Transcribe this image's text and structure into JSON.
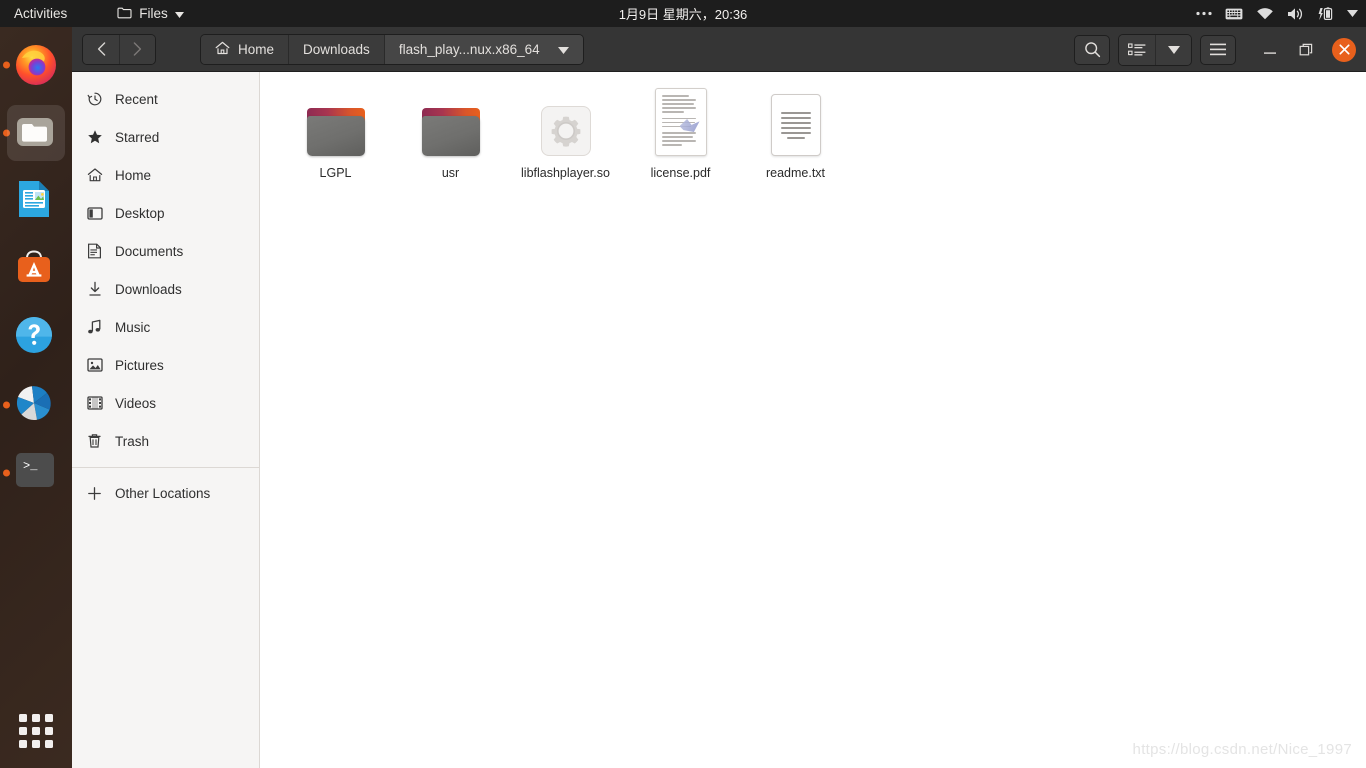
{
  "topbar": {
    "activities": "Activities",
    "app_name": "Files",
    "clock": "1月9日 星期六，20:36",
    "tray": [
      {
        "name": "ellipsis-icon",
        "label": "•••"
      },
      {
        "name": "keyboard-icon",
        "label": "keyboard"
      },
      {
        "name": "wifi-icon",
        "label": "wifi"
      },
      {
        "name": "volume-icon",
        "label": "volume"
      },
      {
        "name": "battery-charging-icon",
        "label": "battery"
      },
      {
        "name": "chevron-down-icon",
        "label": "menu"
      }
    ]
  },
  "dock": {
    "items": [
      {
        "name": "firefox",
        "label": "Firefox",
        "running": true,
        "active": false
      },
      {
        "name": "files",
        "label": "Files",
        "running": true,
        "active": true
      },
      {
        "name": "libreoffice-writer",
        "label": "LibreOffice Writer",
        "running": false,
        "active": false
      },
      {
        "name": "ubuntu-software",
        "label": "Ubuntu Software",
        "running": false,
        "active": false
      },
      {
        "name": "help",
        "label": "Help",
        "running": false,
        "active": false
      },
      {
        "name": "shutter",
        "label": "Shutter",
        "running": true,
        "active": false
      },
      {
        "name": "terminal",
        "label": "Terminal",
        "running": true,
        "active": false
      }
    ],
    "show_applications": "Show Applications"
  },
  "headerbar": {
    "back_label": "Back",
    "forward_label": "Forward",
    "breadcrumbs": [
      {
        "label": "Home",
        "icon": "home-icon",
        "current": false
      },
      {
        "label": "Downloads",
        "icon": "",
        "current": false
      },
      {
        "label": "flash_play...nux.x86_64",
        "icon": "",
        "current": true
      }
    ],
    "search_label": "Search",
    "view_list_label": "List view",
    "view_options_label": "View options",
    "menu_label": "Main menu",
    "minimize_label": "Minimize",
    "maximize_label": "Maximize",
    "close_label": "Close",
    "close_color": "#e8601c"
  },
  "sidebar": {
    "items": [
      {
        "label": "Recent",
        "icon": "clock-icon"
      },
      {
        "label": "Starred",
        "icon": "star-icon"
      },
      {
        "label": "Home",
        "icon": "home-icon"
      },
      {
        "label": "Desktop",
        "icon": "desktop-icon"
      },
      {
        "label": "Documents",
        "icon": "documents-icon"
      },
      {
        "label": "Downloads",
        "icon": "download-icon"
      },
      {
        "label": "Music",
        "icon": "music-icon"
      },
      {
        "label": "Pictures",
        "icon": "pictures-icon"
      },
      {
        "label": "Videos",
        "icon": "videos-icon"
      },
      {
        "label": "Trash",
        "icon": "trash-icon"
      }
    ],
    "other_locations": {
      "label": "Other Locations",
      "icon": "plus-icon"
    }
  },
  "files": [
    {
      "name": "LGPL",
      "type": "folder"
    },
    {
      "name": "usr",
      "type": "folder"
    },
    {
      "name": "libflashplayer.so",
      "type": "library"
    },
    {
      "name": "license.pdf",
      "type": "pdf"
    },
    {
      "name": "readme.txt",
      "type": "text"
    }
  ],
  "watermark": "https://blog.csdn.net/Nice_1997"
}
